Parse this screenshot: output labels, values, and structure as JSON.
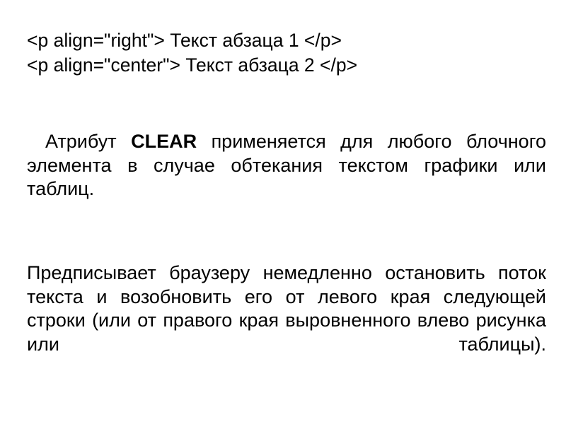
{
  "slide": {
    "background_color": "#ffffff",
    "text_color": "#000000",
    "code_examples": [
      "<p align=\"right\"> Текст абзаца 1 </p>",
      "<p align=\"center\"> Текст абзаца 2 </p>"
    ],
    "paragraphs": [
      {
        "id": "clear-attribute",
        "lead": "Атрибут",
        "emphasis": "CLEAR",
        "rest": "применяется для любого блочного элемента в случае обтекания текстом графики или таблиц.",
        "full_text": "Атрибут CLEAR применяется для любого блочного элемента в случае обтекания текстом графики или таблиц.",
        "alignment": "justify",
        "first_line_indent": true
      },
      {
        "id": "clear-behaviour",
        "full_text": "Предписывает браузеру немедленно остановить поток текста и возобновить его от левого края следующей строки (или от правого края выровненного влево рисунка или таблицы).",
        "alignment": "justify",
        "first_line_indent": false
      }
    ]
  }
}
